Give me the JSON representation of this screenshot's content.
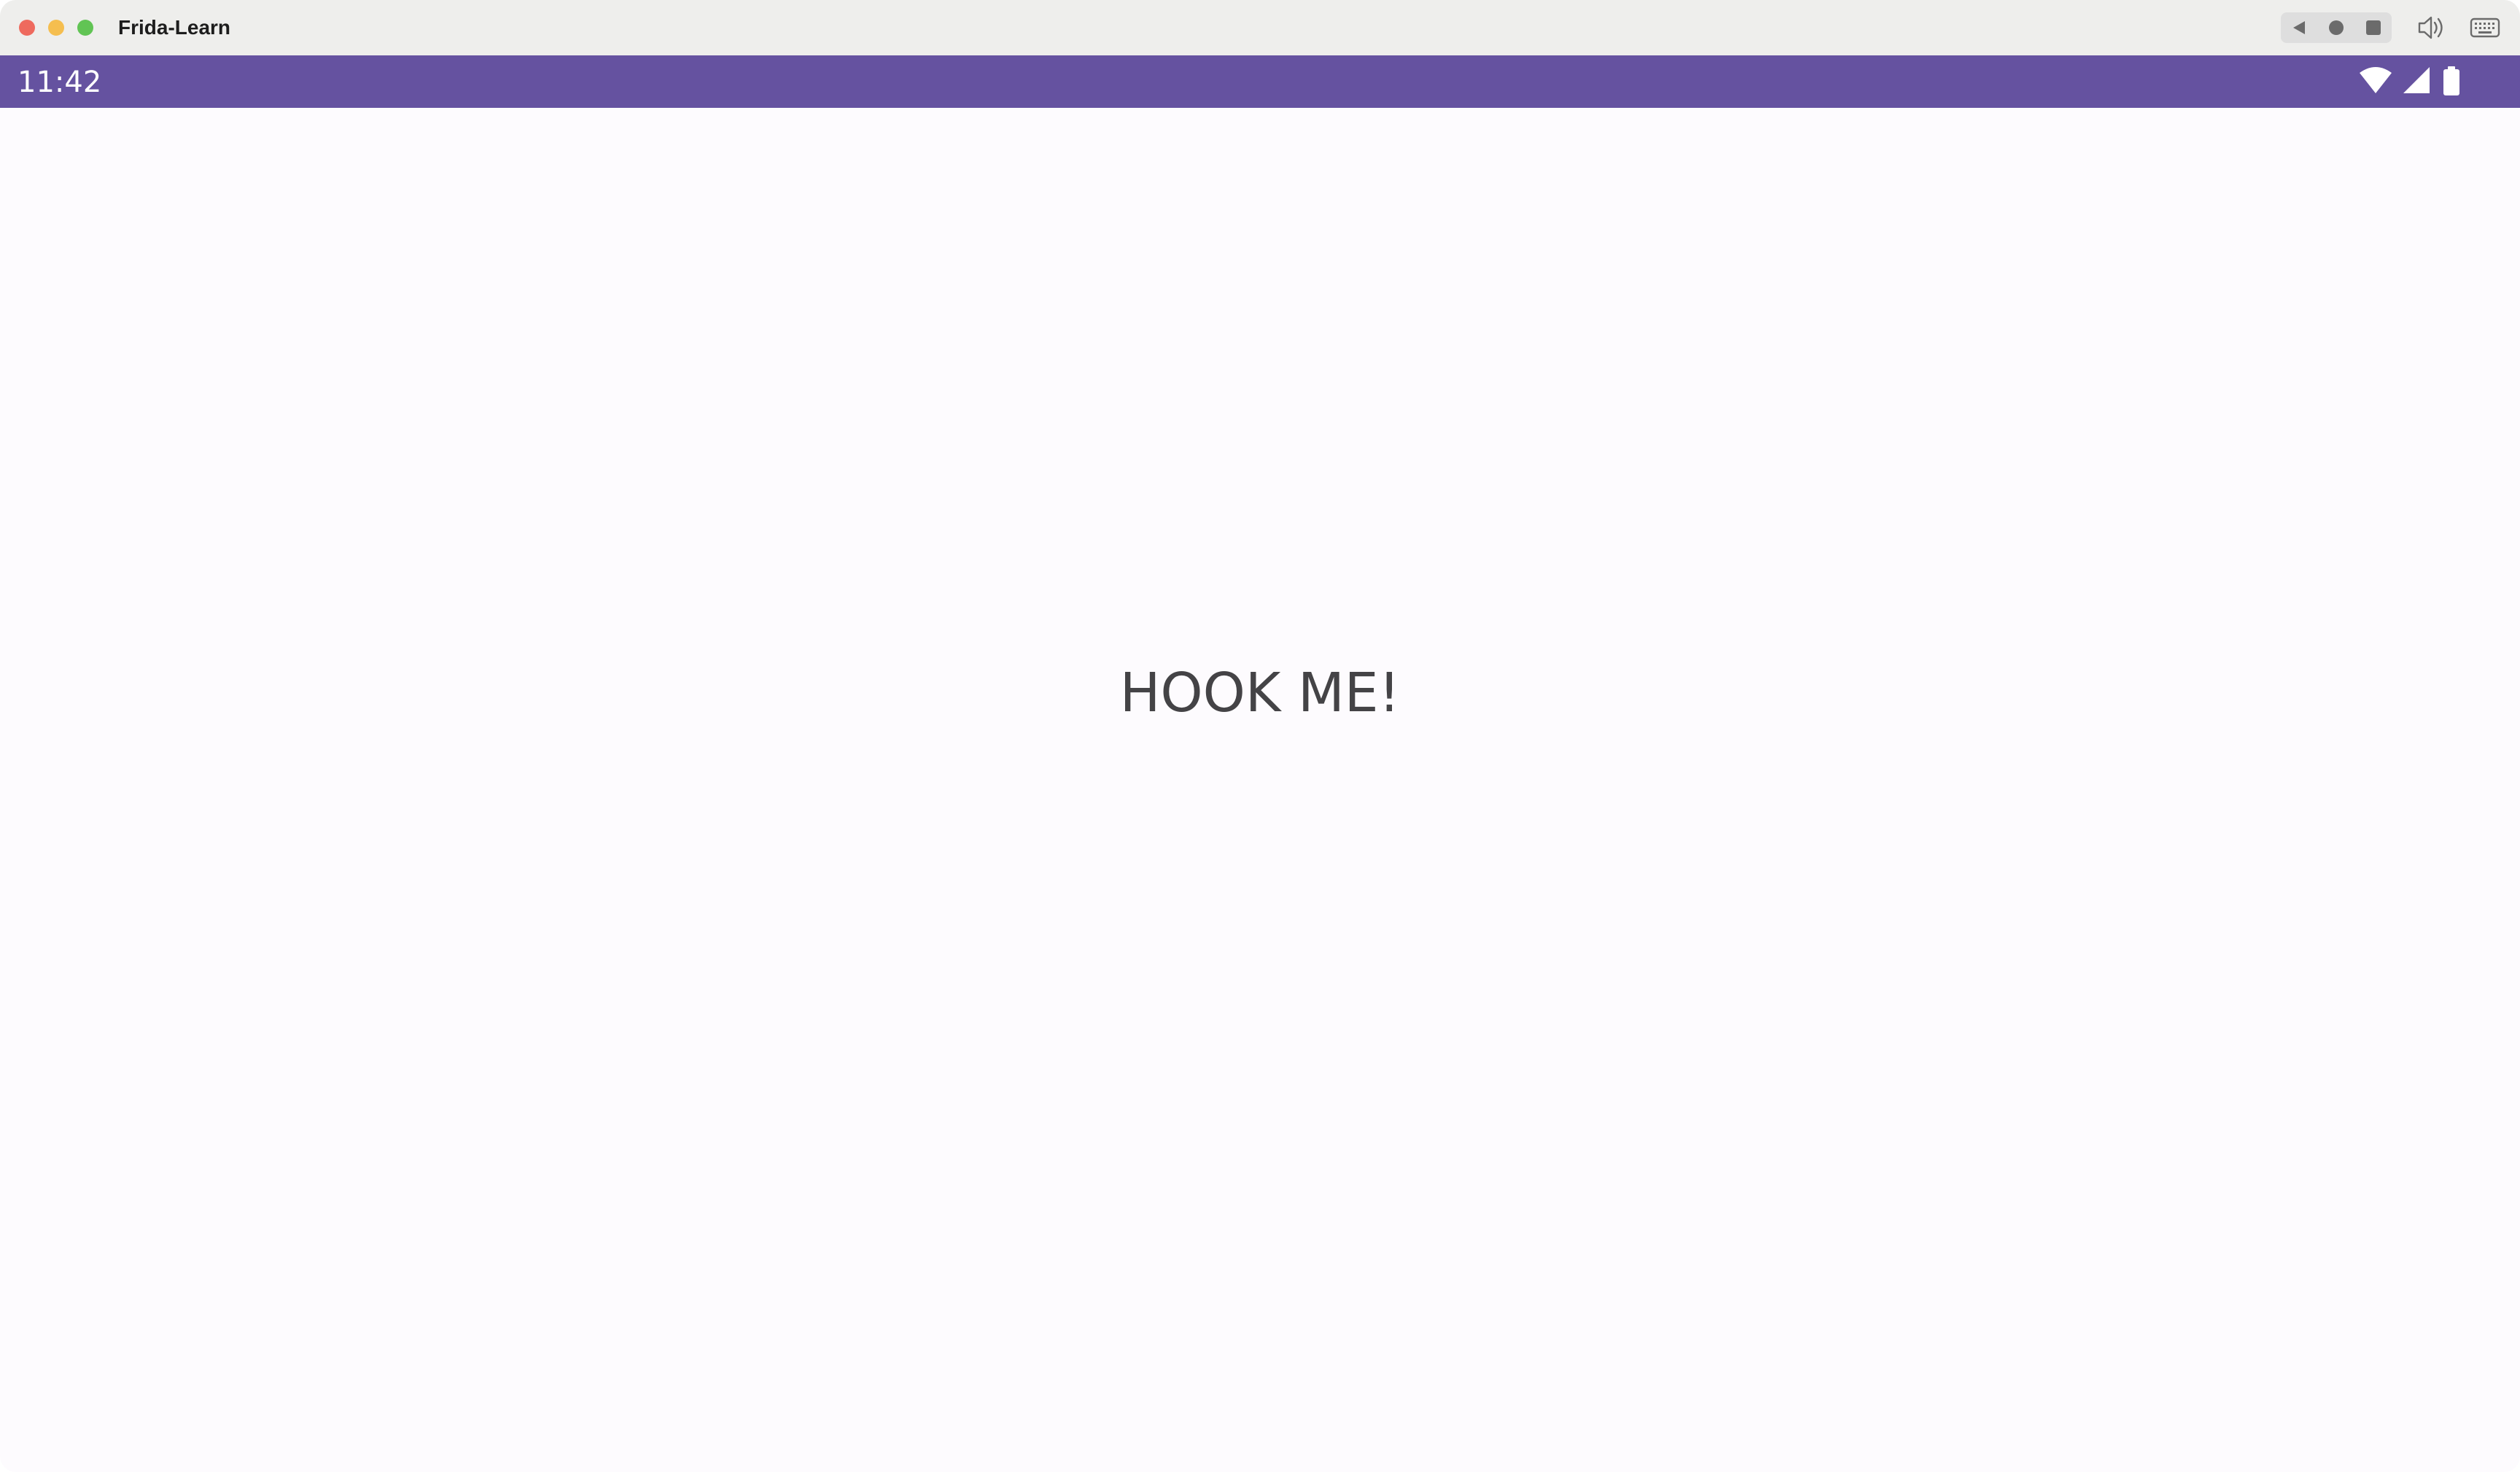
{
  "window": {
    "title": "Frida-Learn",
    "controls": [
      "close",
      "minimize",
      "maximize"
    ]
  },
  "toolbar": {
    "nav_buttons": [
      "back-icon",
      "home-icon",
      "overview-icon"
    ],
    "right_icons": [
      "volume-icon",
      "keyboard-icon"
    ]
  },
  "status_bar": {
    "time": "11:42",
    "icons": [
      "wifi-icon",
      "signal-icon",
      "battery-icon"
    ],
    "color": "#6552a0"
  },
  "main": {
    "text": "HOOK ME!",
    "background": "#fdfbfe"
  }
}
